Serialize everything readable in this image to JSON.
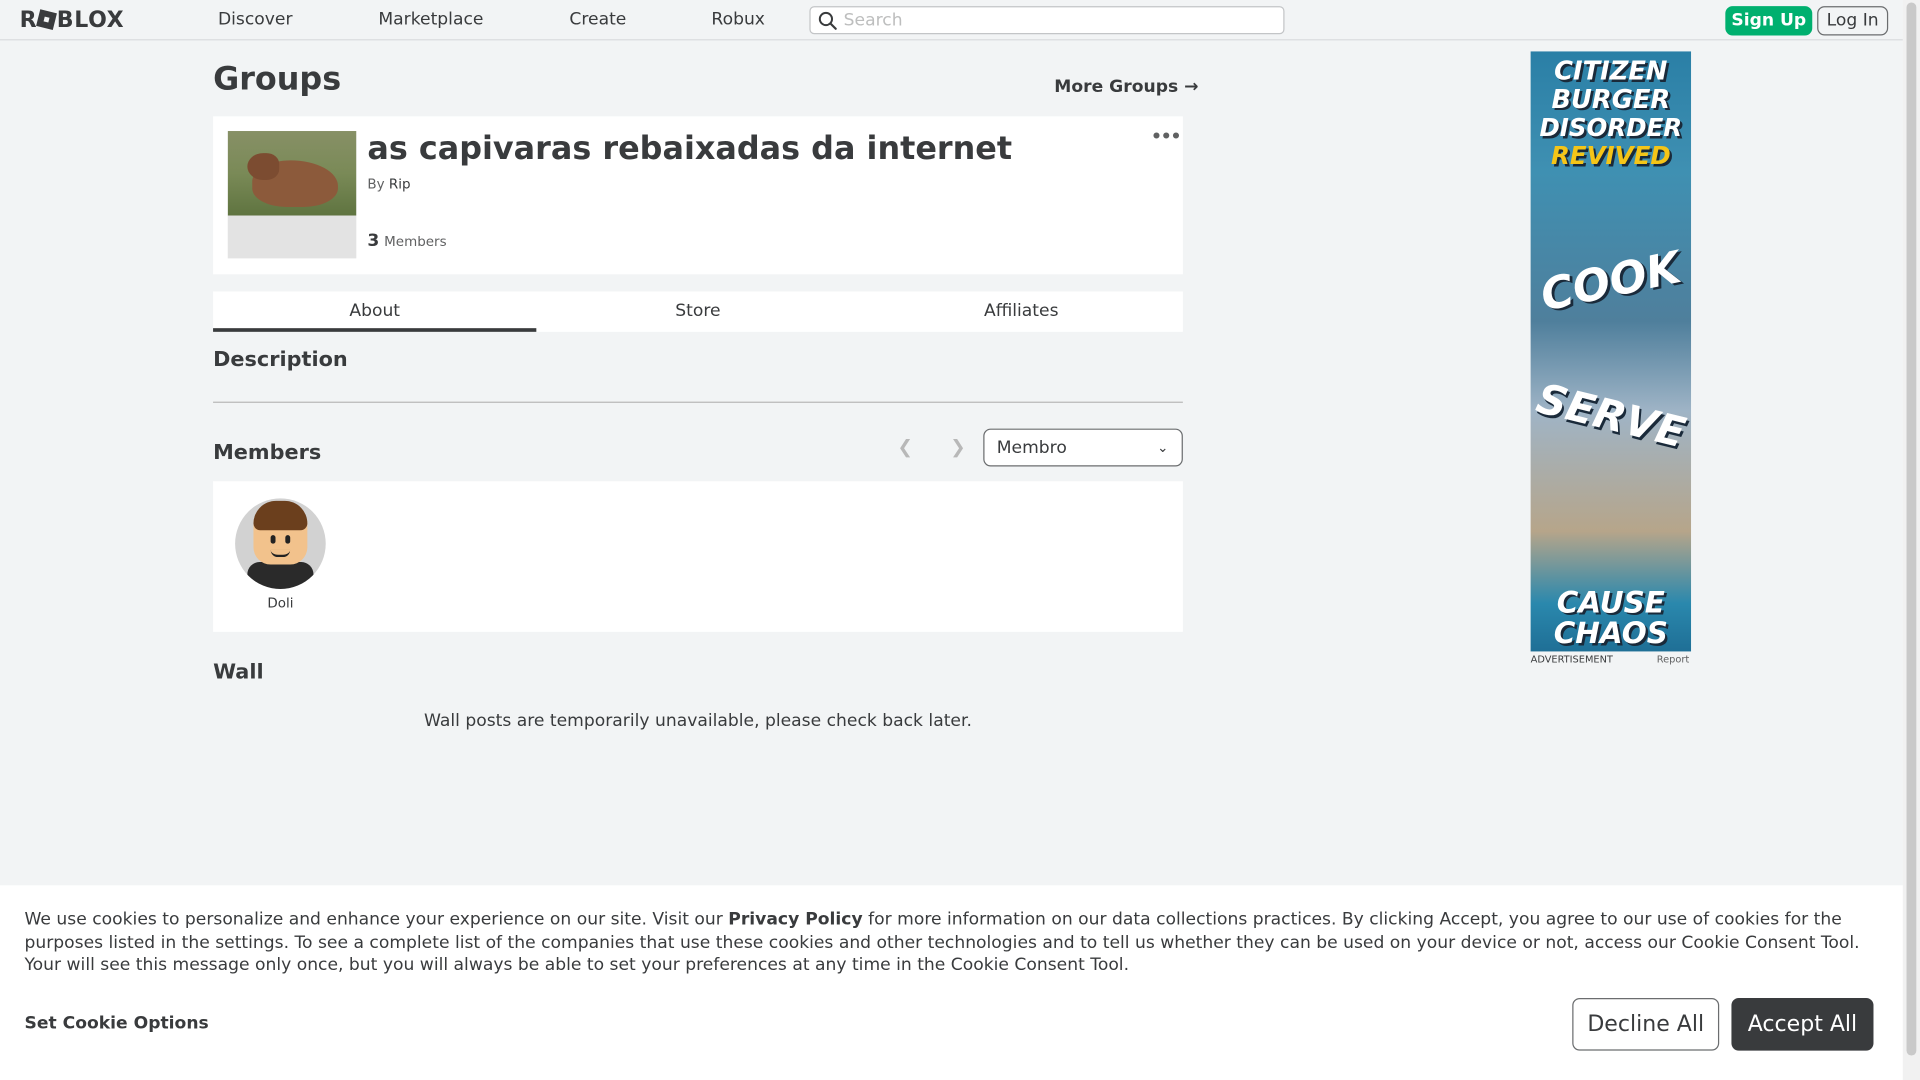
{
  "nav": {
    "logo": "ROBLOX",
    "links": [
      "Discover",
      "Marketplace",
      "Create",
      "Robux"
    ],
    "search_placeholder": "Search",
    "signup": "Sign Up",
    "login": "Log In"
  },
  "page": {
    "title": "Groups",
    "more_groups": "More Groups →"
  },
  "group": {
    "name": "as capivaras rebaixadas da internet",
    "by_label": "By",
    "owner": "Rip",
    "member_count": "3",
    "members_label": "Members",
    "more_icon": "more-icon"
  },
  "tabs": [
    "About",
    "Store",
    "Affiliates"
  ],
  "about": {
    "description_heading": "Description",
    "members_heading": "Members",
    "role_filter": "Membro",
    "members": [
      {
        "name": "Doli"
      }
    ],
    "wall_heading": "Wall",
    "wall_message": "Wall posts are temporarily unavailable, please check back later."
  },
  "ad": {
    "lines": [
      "CITIZEN",
      "BURGER",
      "DISORDER",
      "REVIVED",
      "COOK",
      "SERVE",
      "CAUSE",
      "CHAOS"
    ],
    "label": "ADVERTISEMENT",
    "report": "Report"
  },
  "cookie": {
    "text_before": "We use cookies to personalize and enhance your experience on our site. Visit our ",
    "privacy_link": "Privacy Policy",
    "text_after": " for more information on our data collections practices. By clicking Accept, you agree to our use of cookies for the purposes listed in the settings. To see a complete list of the companies that use these cookies and other technologies and to tell us whether they can be used on your device or not, access our Cookie Consent Tool. Your will see this message only once, but you will always be able to set your preferences at any time in the Cookie Consent Tool.",
    "set_options": "Set Cookie Options",
    "decline": "Decline All",
    "accept": "Accept All"
  },
  "colors": {
    "accent_green": "#00b06f",
    "text": "#393b3d",
    "background": "#f2f4f5"
  }
}
